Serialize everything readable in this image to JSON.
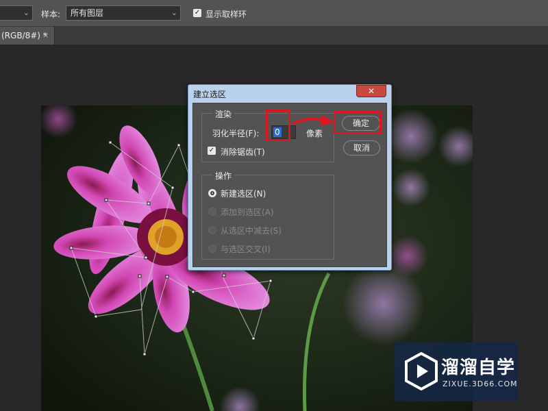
{
  "options_bar": {
    "sample_label": "样本:",
    "sample_value": "所有图层",
    "show_ring_label": "显示取样环"
  },
  "document_tab": {
    "title": "(RGB/8#) *",
    "close": "×"
  },
  "dialog": {
    "title": "建立选区",
    "close": "✕",
    "render_group": {
      "label": "渲染",
      "feather_label": "羽化半径(F):",
      "feather_value": "0",
      "feather_unit": "像素",
      "antialias_label": "消除锯齿(T)",
      "antialias_checked": true
    },
    "operation_group": {
      "label": "操作",
      "options": [
        {
          "label": "新建选区(N)",
          "selected": true,
          "enabled": true
        },
        {
          "label": "添加到选区(A)",
          "selected": false,
          "enabled": false
        },
        {
          "label": "从选区中减去(S)",
          "selected": false,
          "enabled": false
        },
        {
          "label": "与选区交叉(I)",
          "selected": false,
          "enabled": false
        }
      ]
    },
    "ok_label": "确定",
    "cancel_label": "取消"
  },
  "watermark": {
    "name": "溜溜自学",
    "url": "ZIXUE.3D66.COM"
  },
  "colors": {
    "panel": "#535353",
    "workspace": "#282828",
    "annotation_red": "#e0141e",
    "dialog_frame": "#b9d1ea"
  }
}
